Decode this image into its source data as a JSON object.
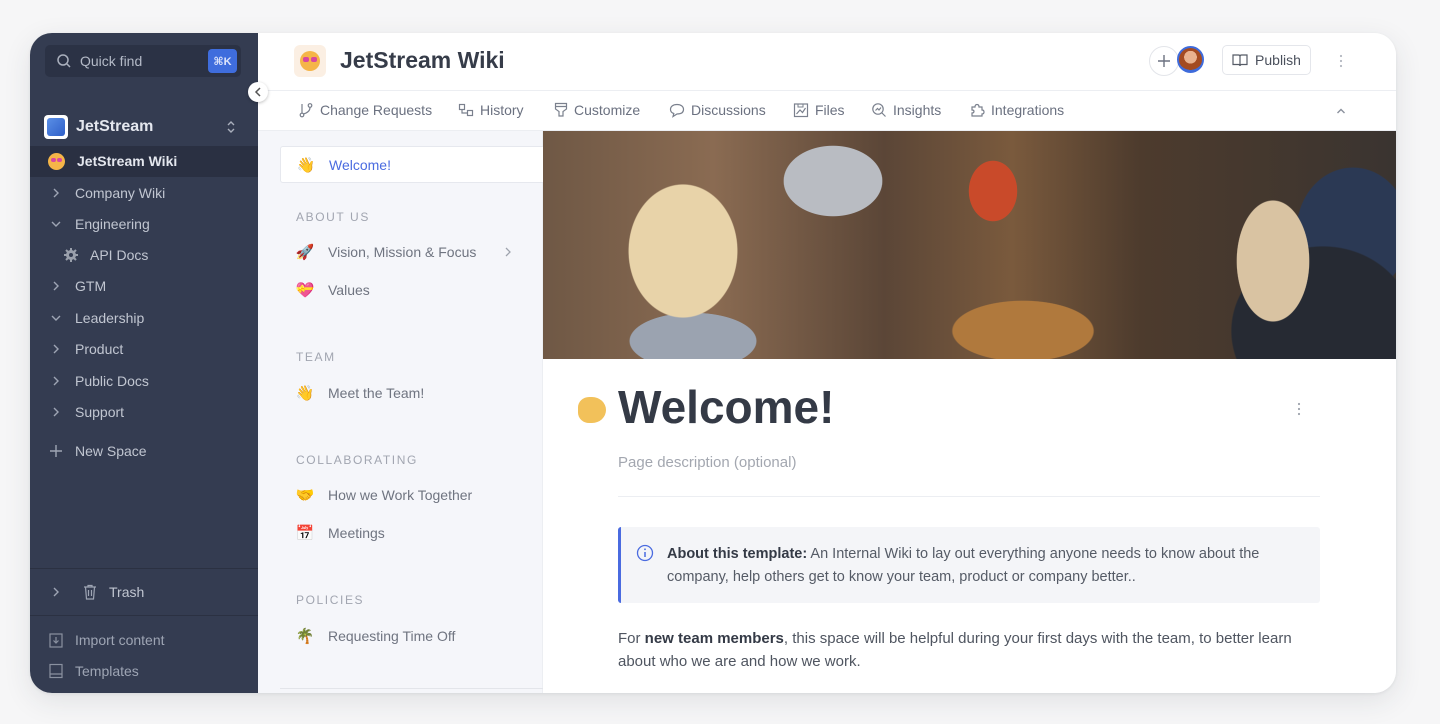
{
  "sidebar": {
    "quick_find": {
      "label": "Quick find",
      "shortcut": "⌘K",
      "icon": "search-icon"
    },
    "workspace": {
      "name": "JetStream",
      "icon": "jetstream-logo"
    },
    "items": [
      {
        "label": "JetStream Wiki",
        "icon": "star-struck-emoji",
        "active": true
      },
      {
        "label": "Company Wiki",
        "expanded": false
      },
      {
        "label": "Engineering",
        "expanded": true
      },
      {
        "label": "API Docs",
        "icon": "gear-icon",
        "child": true
      },
      {
        "label": "GTM",
        "expanded": false
      },
      {
        "label": "Leadership",
        "expanded": true
      },
      {
        "label": "Product",
        "expanded": false
      },
      {
        "label": "Public Docs",
        "expanded": false
      },
      {
        "label": "Support",
        "expanded": false
      }
    ],
    "new_space": "New Space",
    "trash": "Trash",
    "import_content": "Import content",
    "templates": "Templates"
  },
  "header": {
    "space_title": "JetStream Wiki",
    "space_icon": "star-struck-emoji",
    "publish_label": "Publish"
  },
  "tabs": [
    {
      "label": "Change Requests",
      "icon": "branch-icon"
    },
    {
      "label": "History",
      "icon": "history-icon"
    },
    {
      "label": "Customize",
      "icon": "customize-icon"
    },
    {
      "label": "Discussions",
      "icon": "chat-icon"
    },
    {
      "label": "Files",
      "icon": "file-image-icon"
    },
    {
      "label": "Insights",
      "icon": "insights-icon"
    },
    {
      "label": "Integrations",
      "icon": "puzzle-icon"
    }
  ],
  "page_tree": {
    "active": {
      "label": "Welcome!",
      "icon": "👋"
    },
    "sections": [
      {
        "title": "ABOUT US",
        "items": [
          {
            "label": "Vision, Mission & Focus",
            "icon": "🚀",
            "has_children": true
          },
          {
            "label": "Values",
            "icon": "💝"
          }
        ]
      },
      {
        "title": "TEAM",
        "items": [
          {
            "label": "Meet the Team!",
            "icon": "👋"
          }
        ]
      },
      {
        "title": "COLLABORATING",
        "items": [
          {
            "label": "How we Work Together",
            "icon": "🤝"
          },
          {
            "label": "Meetings",
            "icon": "📅"
          }
        ]
      },
      {
        "title": "POLICIES",
        "items": [
          {
            "label": "Requesting Time Off",
            "icon": "🌴"
          }
        ]
      }
    ]
  },
  "page": {
    "title": "Welcome!",
    "icon": "👋",
    "description_placeholder": "Page description (optional)",
    "callout": {
      "bold": "About this template:",
      "text": " An Internal Wiki to lay out everything anyone needs to know about the company, help others get to know your team, product or company better.."
    },
    "body": {
      "prefix": "For ",
      "bold": "new team members",
      "suffix": ", this space will be helpful during your first days with the team, to better learn about who we are and how we work."
    }
  },
  "colors": {
    "sidebar_bg": "#343c51",
    "accent": "#4a6be0",
    "shortcut_bg": "#3f6ddd"
  }
}
